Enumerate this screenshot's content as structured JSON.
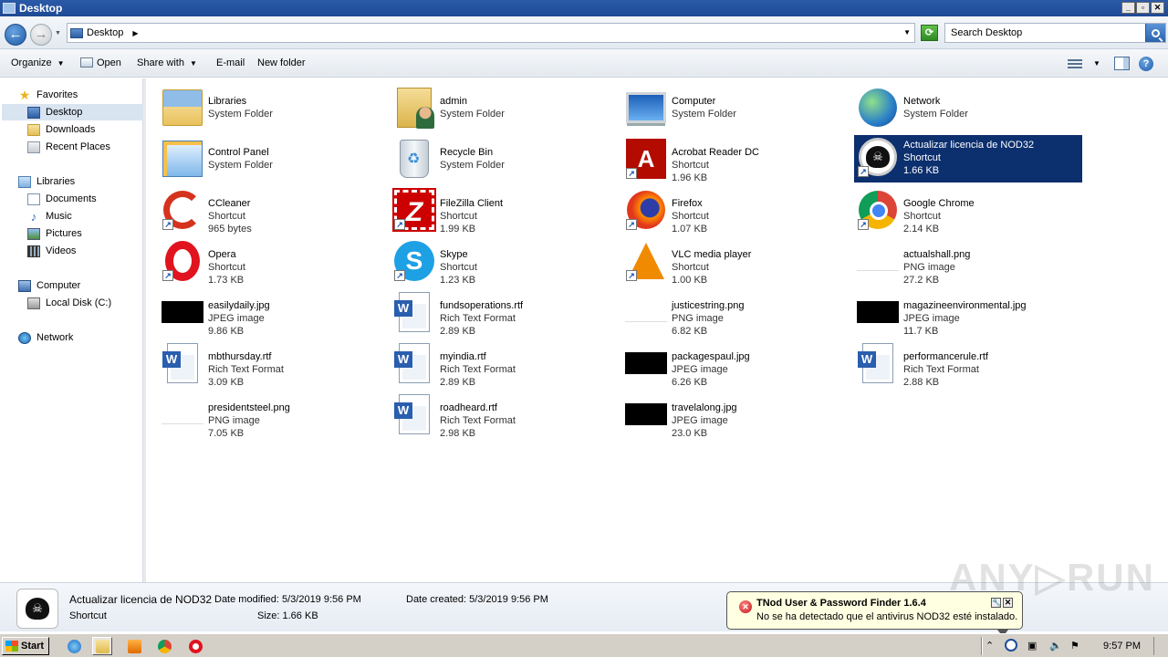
{
  "window": {
    "title": "Desktop"
  },
  "window_buttons": {
    "minimize": "_",
    "maximize": "▫",
    "close": "✕"
  },
  "address": {
    "crumb": "Desktop"
  },
  "search": {
    "placeholder": "Search Desktop"
  },
  "toolbar": {
    "organize": "Organize",
    "open": "Open",
    "share_with": "Share with",
    "email": "E-mail",
    "new_folder": "New folder"
  },
  "sidebar": {
    "favorites": "Favorites",
    "desktop": "Desktop",
    "downloads": "Downloads",
    "recent_places": "Recent Places",
    "libraries": "Libraries",
    "documents": "Documents",
    "music": "Music",
    "pictures": "Pictures",
    "videos": "Videos",
    "computer": "Computer",
    "local_disk": "Local Disk (C:)",
    "network": "Network"
  },
  "files": [
    {
      "name": "Libraries",
      "type": "System Folder",
      "size": ""
    },
    {
      "name": "admin",
      "type": "System Folder",
      "size": ""
    },
    {
      "name": "Computer",
      "type": "System Folder",
      "size": ""
    },
    {
      "name": "Network",
      "type": "System Folder",
      "size": ""
    },
    {
      "name": "Control Panel",
      "type": "System Folder",
      "size": ""
    },
    {
      "name": "Recycle Bin",
      "type": "System Folder",
      "size": ""
    },
    {
      "name": "Acrobat Reader DC",
      "type": "Shortcut",
      "size": "1.96 KB"
    },
    {
      "name": "Actualizar licencia de NOD32",
      "type": "Shortcut",
      "size": "1.66 KB"
    },
    {
      "name": "CCleaner",
      "type": "Shortcut",
      "size": "965 bytes"
    },
    {
      "name": "FileZilla Client",
      "type": "Shortcut",
      "size": "1.99 KB"
    },
    {
      "name": "Firefox",
      "type": "Shortcut",
      "size": "1.07 KB"
    },
    {
      "name": "Google Chrome",
      "type": "Shortcut",
      "size": "2.14 KB"
    },
    {
      "name": "Opera",
      "type": "Shortcut",
      "size": "1.73 KB"
    },
    {
      "name": "Skype",
      "type": "Shortcut",
      "size": "1.23 KB"
    },
    {
      "name": "VLC media player",
      "type": "Shortcut",
      "size": "1.00 KB"
    },
    {
      "name": "actualshall.png",
      "type": "PNG image",
      "size": "27.2 KB"
    },
    {
      "name": "easilydaily.jpg",
      "type": "JPEG image",
      "size": "9.86 KB"
    },
    {
      "name": "fundsoperations.rtf",
      "type": "Rich Text Format",
      "size": "2.89 KB"
    },
    {
      "name": "justicestring.png",
      "type": "PNG image",
      "size": "6.82 KB"
    },
    {
      "name": "magazineenvironmental.jpg",
      "type": "JPEG image",
      "size": "11.7 KB"
    },
    {
      "name": "mbthursday.rtf",
      "type": "Rich Text Format",
      "size": "3.09 KB"
    },
    {
      "name": "myindia.rtf",
      "type": "Rich Text Format",
      "size": "2.89 KB"
    },
    {
      "name": "packagespaul.jpg",
      "type": "JPEG image",
      "size": "6.26 KB"
    },
    {
      "name": "performancerule.rtf",
      "type": "Rich Text Format",
      "size": "2.88 KB"
    },
    {
      "name": "presidentsteel.png",
      "type": "PNG image",
      "size": "7.05 KB"
    },
    {
      "name": "roadheard.rtf",
      "type": "Rich Text Format",
      "size": "2.98 KB"
    },
    {
      "name": "travelalong.jpg",
      "type": "JPEG image",
      "size": "23.0 KB"
    }
  ],
  "details": {
    "name": "Actualizar licencia de NOD32",
    "type": "Shortcut",
    "date_modified": "Date modified: 5/3/2019 9:56 PM",
    "size": "Size: 1.66 KB",
    "date_created": "Date created: 5/3/2019 9:56 PM"
  },
  "notification": {
    "title": "TNod User & Password Finder 1.6.4",
    "message": "No se ha detectado que el antivirus NOD32 esté instalado.",
    "close": "✕"
  },
  "watermark": "ANY▷RUN",
  "taskbar": {
    "start": "Start",
    "clock": "9:57 PM"
  }
}
